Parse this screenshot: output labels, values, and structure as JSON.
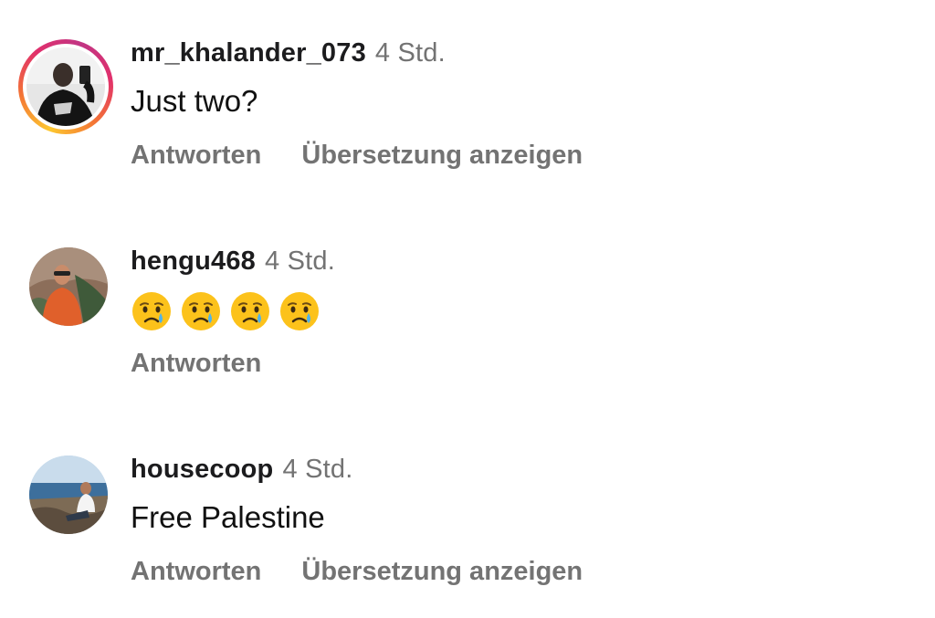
{
  "comments": [
    {
      "username": "mr_khalander_073",
      "time": "4 Std.",
      "text": "Just two?",
      "reply_label": "Antworten",
      "translate_label": "Übersetzung anzeigen",
      "has_story_ring": true,
      "avatar_icon": "avatar-photo-selfie"
    },
    {
      "username": "hengu468",
      "time": "4 Std.",
      "emojis": [
        "crying-face",
        "crying-face",
        "crying-face",
        "crying-face"
      ],
      "reply_label": "Antworten",
      "has_story_ring": false,
      "avatar_icon": "avatar-photo-person-outdoors"
    },
    {
      "username": "housecoop",
      "time": "4 Std.",
      "text": "Free Palestine",
      "reply_label": "Antworten",
      "translate_label": "Übersetzung anzeigen",
      "has_story_ring": false,
      "avatar_icon": "avatar-photo-beach"
    }
  ],
  "colors": {
    "username": "#1c1c1e",
    "meta": "#737373",
    "text": "#111111",
    "story_ring_start": "#fdc830",
    "story_ring_end": "#c13584"
  }
}
